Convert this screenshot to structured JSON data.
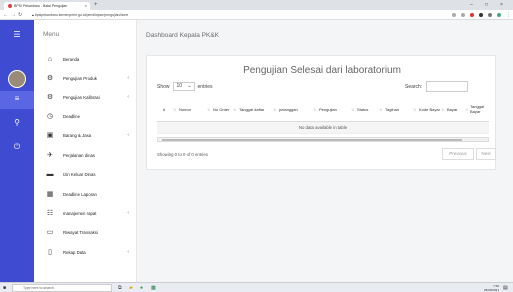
{
  "browser": {
    "tab_title": "BPSI Pekanbaru - Balai Pengujian",
    "new_tab_icon": "plus-icon",
    "url": "bpsipekanbaru.kemenperin.go.id/pemilidpse/pengujian/done"
  },
  "header": {
    "title": "Dashboard Kepala PK&K"
  },
  "sidebar": {
    "title": "Menu",
    "items": [
      {
        "label": "Beranda",
        "icon": "home-icon",
        "arrow": ""
      },
      {
        "label": "Pengujian Produk",
        "icon": "gears-icon",
        "arrow": "‹"
      },
      {
        "label": "Pengujian Kalibrasi",
        "icon": "gears-icon",
        "arrow": "‹"
      },
      {
        "label": "Deadline",
        "icon": "clock-icon",
        "arrow": ""
      },
      {
        "label": "Barang & Jasa",
        "icon": "box-icon",
        "arrow": "‹"
      },
      {
        "label": "Perjalanan dinas",
        "icon": "plane-icon",
        "arrow": ""
      },
      {
        "label": "Izin Keluar Dinas",
        "icon": "car-icon",
        "arrow": ""
      },
      {
        "label": "Deadline Laporan",
        "icon": "calendar-icon",
        "arrow": ""
      },
      {
        "label": "manajemen rapat",
        "icon": "users-icon",
        "arrow": "‹"
      },
      {
        "label": "Riwayat Transaksi",
        "icon": "card-icon",
        "arrow": ""
      },
      {
        "label": "Rekap Data",
        "icon": "document-icon",
        "arrow": "‹"
      }
    ]
  },
  "table_card": {
    "title": "Pengujian Selesai dari laboratorium",
    "show_label": "Show",
    "page_size": "10",
    "entries_label": "entries",
    "search_label": "Search:",
    "columns": [
      "#",
      "Nomor",
      "No Order",
      "Tanggal daftar",
      "pelanggan",
      "Pengujian",
      "Status",
      "Tagihan",
      "Kode Bayar",
      "Bayar",
      "Tanggal Bayar"
    ],
    "empty_text": "No data available in table",
    "info": "Showing 0 to 0 of 0 entries",
    "prev": "Previous",
    "next": "Next"
  },
  "taskbar": {
    "search_placeholder": "Type here to search",
    "time": "7:56",
    "date": "28/09/2021"
  },
  "colors": {
    "accent": "#3f4bd1",
    "rail_active": "#5a66e3"
  }
}
